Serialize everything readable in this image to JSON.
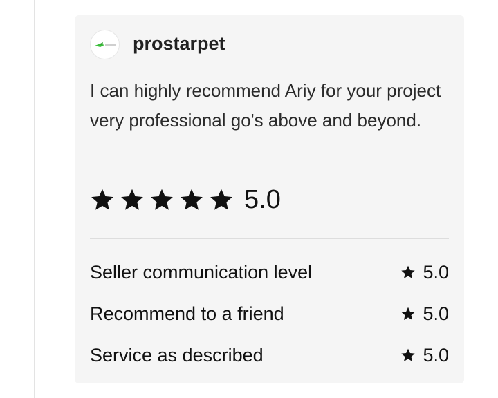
{
  "review": {
    "username": "prostarpet",
    "avatar_icon": "green-logo-icon",
    "text": "I can highly recommend Ariy for your project very professional go's above and beyond.",
    "stars": 5,
    "overall_rating": "5.0",
    "star_color": "#111111"
  },
  "sub_ratings": [
    {
      "label": "Seller communication level",
      "score": "5.0"
    },
    {
      "label": "Recommend to a friend",
      "score": "5.0"
    },
    {
      "label": "Service as described",
      "score": "5.0"
    }
  ]
}
